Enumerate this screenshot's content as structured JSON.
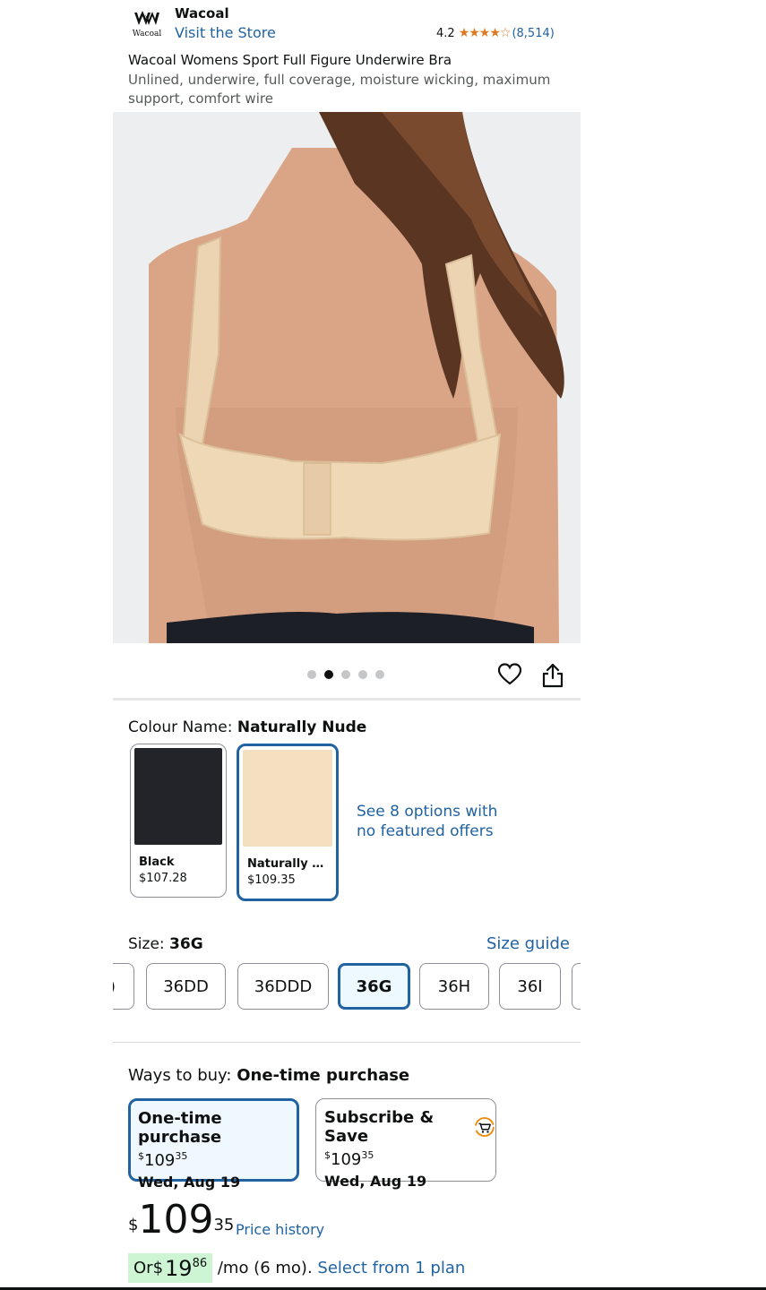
{
  "header": {
    "brand": "Wacoal",
    "logo_text": "Wacoal",
    "visit_store": "Visit the Store",
    "rating_value": "4.2",
    "rating_stars": "★★★★☆",
    "rating_count": "(8,514)"
  },
  "product": {
    "title": "Wacoal Womens Sport Full Figure Underwire Bra",
    "subtitle": "Unlined, underwire, full coverage, moisture wicking, maximum support, comfort wire",
    "image_count": 5,
    "active_image": 2
  },
  "colour": {
    "label": "Colour Name:",
    "selected": "Naturally Nude",
    "options": [
      {
        "name": "Black",
        "price": "$107.28",
        "color": "#23232a"
      },
      {
        "name": "Naturally N...",
        "price": "$109.35",
        "color": "#f4dfc0"
      }
    ],
    "see_options": "See 8 options with no featured offers"
  },
  "size": {
    "label": "Size:",
    "selected": "36G",
    "guide": "Size guide",
    "options": [
      ")",
      "36DD",
      "36DDD",
      "36G",
      "36H",
      "36I",
      ""
    ]
  },
  "ways_to_buy": {
    "label": "Ways to buy:",
    "selected": "One-time purchase",
    "cards": [
      {
        "title": "One-time purchase",
        "price_symbol": "$",
        "price_whole": "109",
        "price_fraction": "35",
        "date": "Wed, Aug 19"
      },
      {
        "title": "Subscribe & Save",
        "price_symbol": "$",
        "price_whole": "109",
        "price_fraction": "35",
        "date": "Wed, Aug 19"
      }
    ]
  },
  "price": {
    "symbol": "$",
    "whole": "109",
    "fraction": "35",
    "history": "Price history"
  },
  "installment": {
    "prefix": "Or ",
    "symbol": "$",
    "whole": "19",
    "fraction": "86",
    "suffix": " /mo (6 mo). ",
    "link": "Select from 1 plan"
  },
  "colors": {
    "link": "#2162a1",
    "star": "#de7921",
    "selected_border": "#2162a1",
    "emi_highlight": "#cdf5d4"
  }
}
